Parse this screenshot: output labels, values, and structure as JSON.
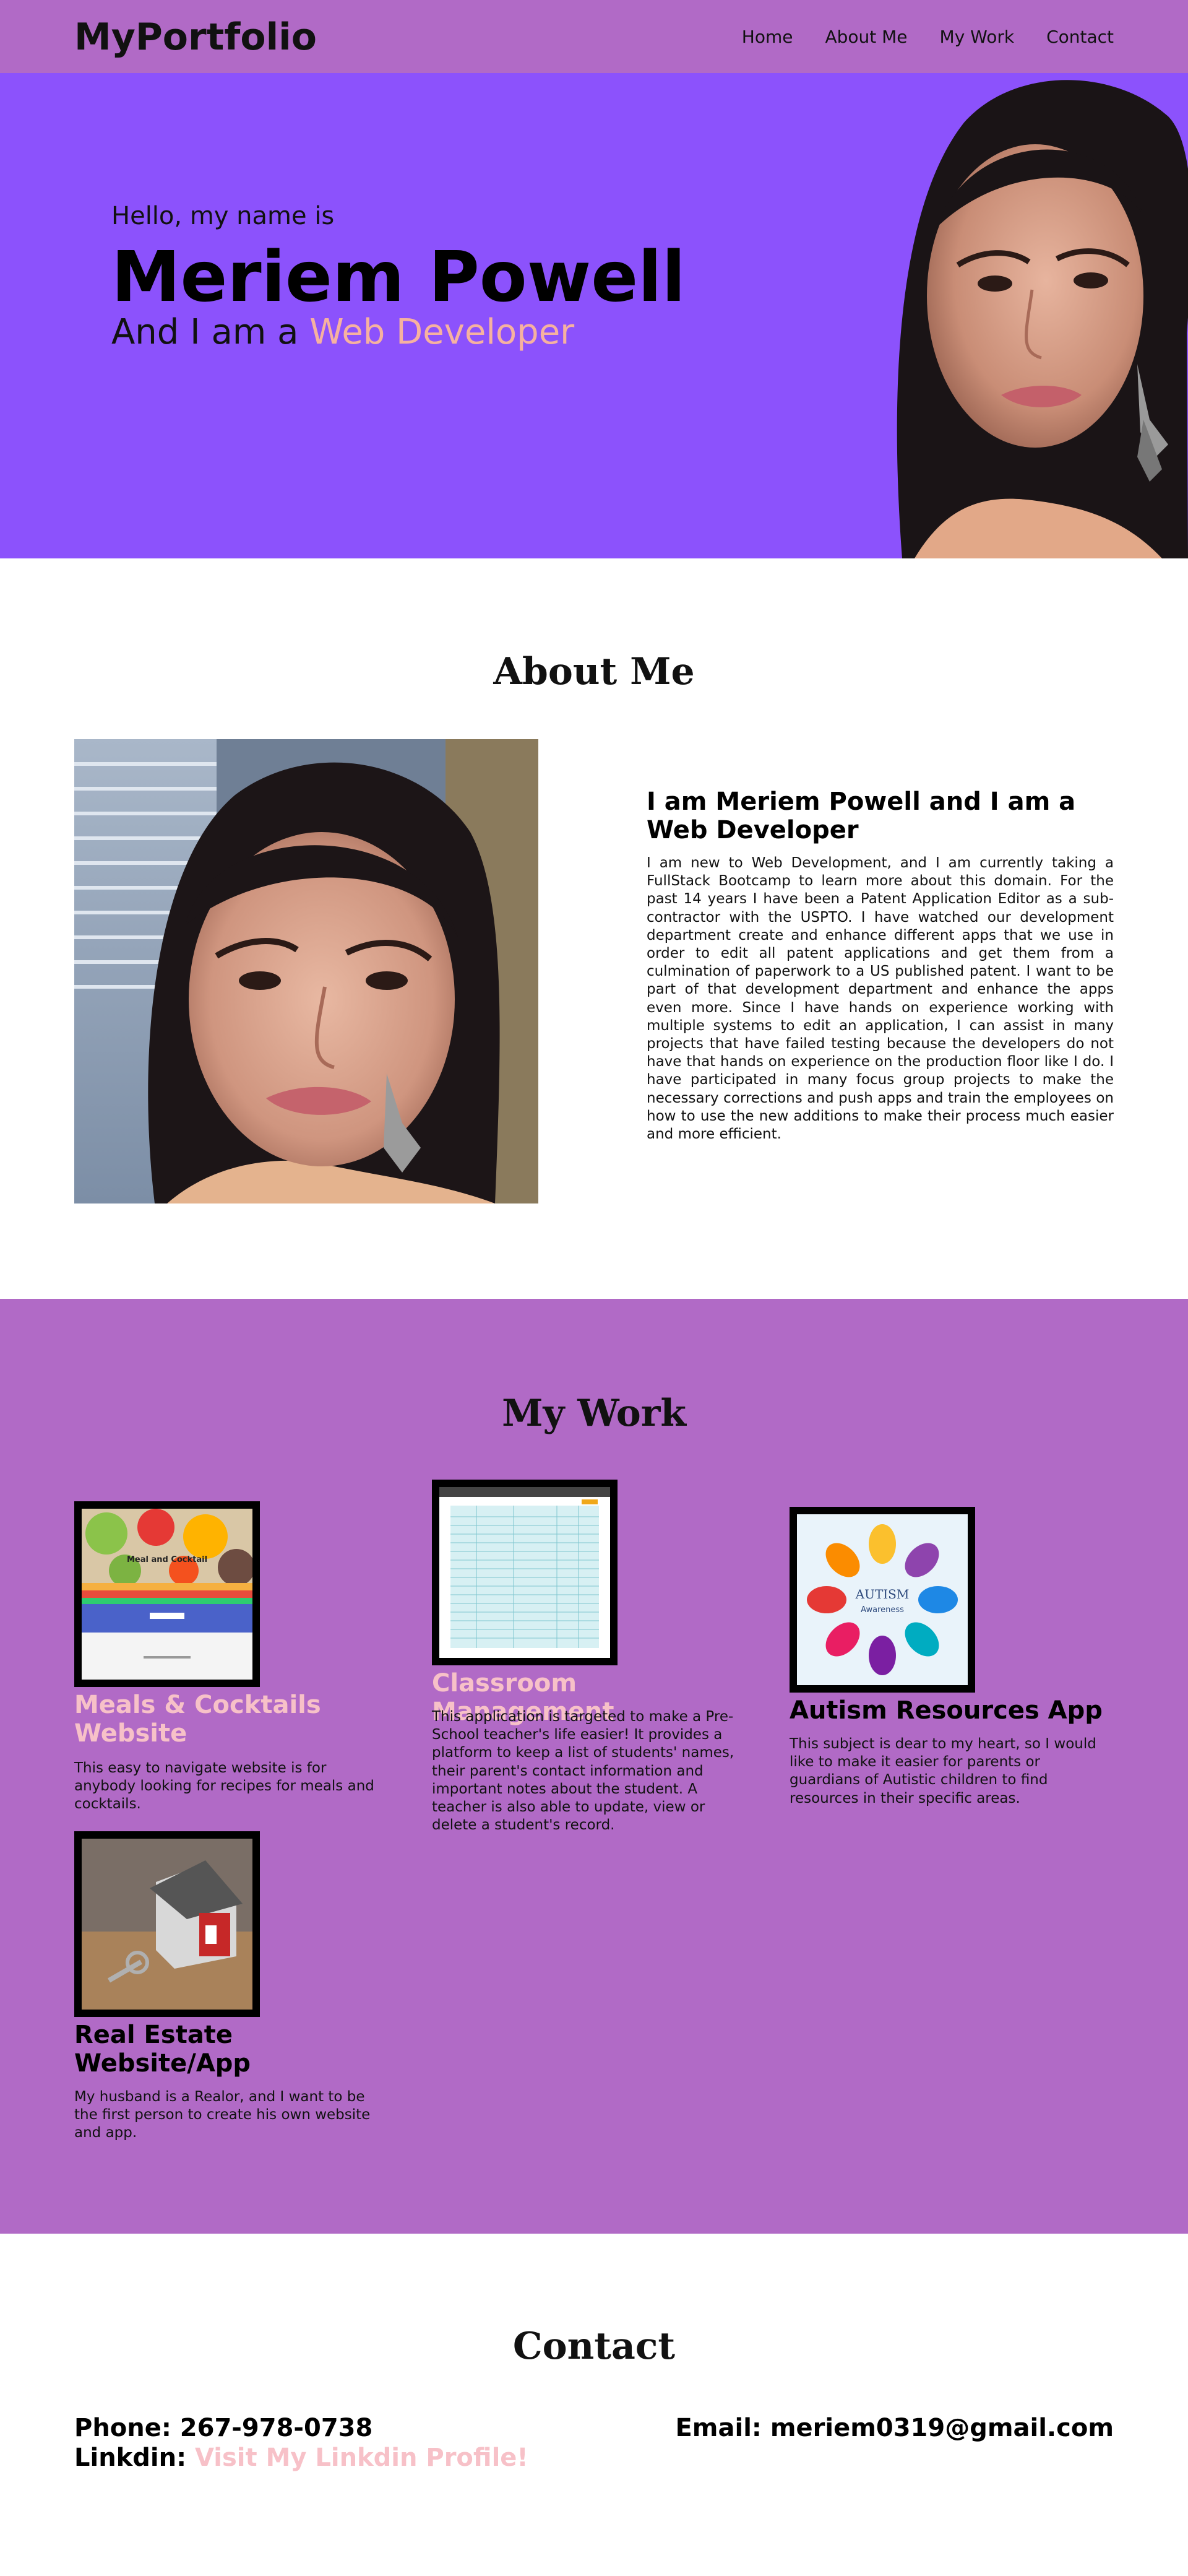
{
  "nav": {
    "brand": "MyPortfolio",
    "links": [
      "Home",
      "About Me",
      "My Work",
      "Contact"
    ]
  },
  "hero": {
    "greeting": "Hello, my name is",
    "name": "Meriem Powell",
    "role_prefix": "And I am a",
    "role": "Web Developer"
  },
  "about": {
    "title": "About Me",
    "heading": "I am Meriem Powell and I am a Web Developer",
    "body": "I am new to Web Development, and I am currently taking a FullStack Bootcamp to learn more about this domain. For the past 14 years I have been a Patent Application Editor as a sub-contractor with the USPTO. I have watched our development department create and enhance different apps that we use in order to edit all patent applications and get them from a culmination of paperwork to a US published patent. I want to be part of that development department and enhance the apps even more. Since I have hands on experience working with multiple systems to edit an application, I can assist in many projects that have failed testing because the developers do not have that hands on experience on the production floor like I do. I have participated in many focus group projects to make the necessary corrections and push apps and train the employees on how to use the new additions to make their process much easier and more efficient."
  },
  "work": {
    "title": "My Work",
    "projects": [
      {
        "title": "Meals & Cocktails Website",
        "description": "This easy to navigate website is for anybody looking for recipes for meals and cocktails.",
        "thumb_text": "Meal and Cocktail"
      },
      {
        "title": "Classroom Management",
        "description": "This application is targeted to make a Pre-School teacher's life easier! It provides a platform to keep a list of students' names, their parent's contact information and important notes about the student. A teacher is also able to update, view or delete a student's record."
      },
      {
        "title": "Autism Resources App",
        "description": "This subject is dear to my heart, so I would like to make it easier for parents or guardians of Autistic children to find resources in their specific areas.",
        "thumb_title": "AUTISM",
        "thumb_sub": "Awareness"
      },
      {
        "title": "Real Estate Website/App",
        "description": "My husband is a Realor, and I want to be the first person to create his own website and app."
      }
    ]
  },
  "contact": {
    "title": "Contact",
    "phone_label": "Phone: 267-978-0738",
    "email_label": "Email: meriem0319@gmail.com",
    "linkedin_label": "Linkdin:",
    "linkedin_link": "Visit My Linkdin Profile!"
  },
  "colors": {
    "nav_bg": "#b16ac6",
    "hero_bg": "#8c52fc",
    "accent_peach": "#f6b1a0",
    "accent_pink": "#f7c1c8",
    "work_bg": "#b16ac6"
  }
}
